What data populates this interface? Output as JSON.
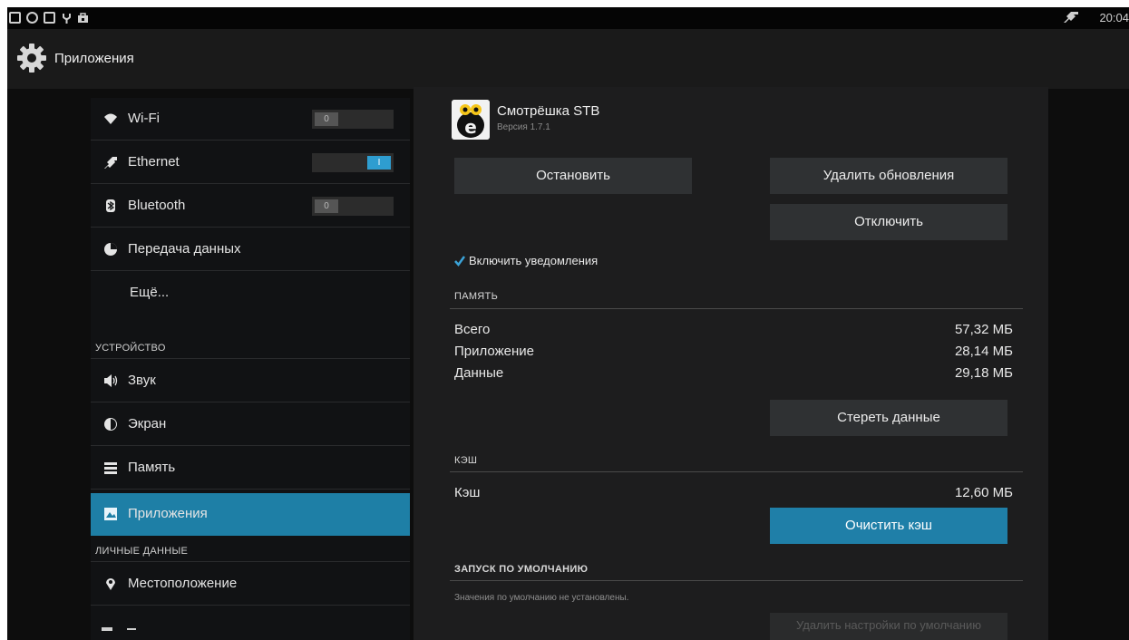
{
  "status_bar": {
    "time": "20:04"
  },
  "action_bar": {
    "title": "Приложения"
  },
  "sidebar": {
    "items": [
      {
        "label": "Wi-Fi",
        "icon": "wifi-icon",
        "toggle": "0"
      },
      {
        "label": "Ethernet",
        "icon": "ethernet-icon",
        "toggle": "I"
      },
      {
        "label": "Bluetooth",
        "icon": "bluetooth-icon",
        "toggle": "0"
      },
      {
        "label": "Передача данных",
        "icon": "data-usage-icon"
      },
      {
        "label": "Ещё..."
      },
      {
        "label": "Звук",
        "icon": "speaker-icon"
      },
      {
        "label": "Экран",
        "icon": "display-icon"
      },
      {
        "label": "Память",
        "icon": "storage-icon"
      },
      {
        "label": "Приложения",
        "icon": "apps-icon"
      },
      {
        "label": "Местоположение",
        "icon": "location-icon"
      }
    ],
    "section_device": "УСТРОЙСТВО",
    "section_personal": "ЛИЧНЫЕ ДАННЫЕ"
  },
  "app": {
    "name": "Смотрёшка STB",
    "version": "Версия 1.7.1"
  },
  "buttons": {
    "stop": "Остановить",
    "uninstall_updates": "Удалить обновления",
    "disable": "Отключить",
    "clear_data": "Стереть данные",
    "clear_cache": "Очистить кэш",
    "clear_defaults": "Удалить настройки по умолчанию"
  },
  "notifications": {
    "label": "Включить уведомления",
    "checked": true
  },
  "storage": {
    "title": "ПАМЯТЬ",
    "rows": [
      {
        "label": "Всего",
        "value": "57,32 МБ"
      },
      {
        "label": "Приложение",
        "value": "28,14 МБ"
      },
      {
        "label": "Данные",
        "value": "29,18 МБ"
      }
    ]
  },
  "cache": {
    "title": "КЭШ",
    "label": "Кэш",
    "value": "12,60 МБ"
  },
  "launch": {
    "title": "ЗАПУСК ПО УМОЛЧАНИЮ",
    "note": "Значения по умолчанию не установлены."
  },
  "colors": {
    "accent": "#1f7fa8",
    "toggle_on": "#2e9dd0",
    "background": "#0d0d0d",
    "panel": "#1d1d1e"
  }
}
